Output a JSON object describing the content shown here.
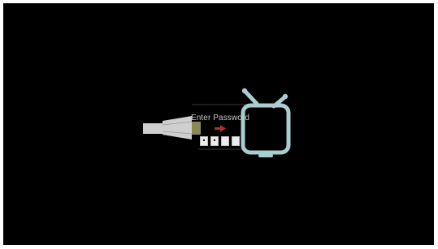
{
  "prompt": {
    "label": "Enter Password"
  },
  "password": {
    "slots": [
      "•",
      "•",
      "",
      ""
    ]
  },
  "icons": {
    "cable": "hdmi-cable-icon",
    "tv": "tv-icon",
    "arrow": "right-arrow-icon"
  },
  "colors": {
    "background": "#000000",
    "cable": "#cfcfcf",
    "cable_tip": "#8a8a55",
    "tv": "#a9cdd1",
    "arrow": "#b0302c",
    "box_fill": "#ececec"
  }
}
